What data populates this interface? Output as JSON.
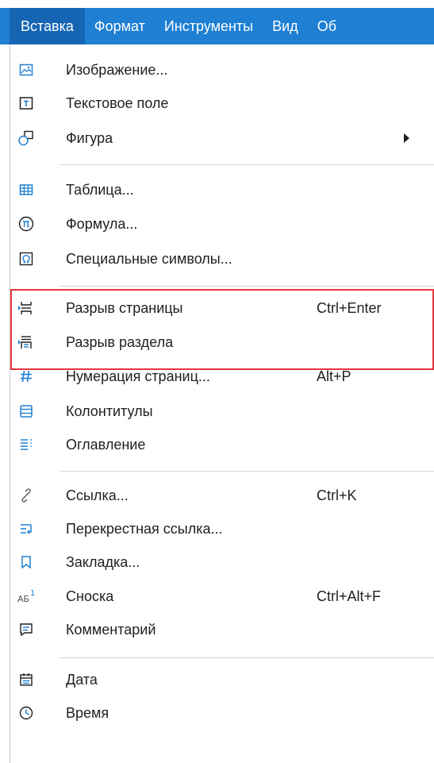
{
  "menubar": {
    "items": [
      {
        "label": "Вставка",
        "active": true
      },
      {
        "label": "Формат"
      },
      {
        "label": "Инструменты"
      },
      {
        "label": "Вид"
      },
      {
        "label": "Об"
      }
    ]
  },
  "colors": {
    "menubar_bg": "#1e7fd3",
    "menubar_active_bg": "#1565b3",
    "icon_blue": "#1e7fd3",
    "highlight_border": "#e53340"
  },
  "menu": {
    "items": [
      {
        "label": "Изображение...",
        "icon": "image-icon"
      },
      {
        "label": "Текстовое поле",
        "icon": "text-field-icon"
      },
      {
        "label": "Фигура",
        "icon": "shape-icon",
        "submenu": true
      },
      {
        "label": "Таблица...",
        "icon": "table-icon"
      },
      {
        "label": "Формула...",
        "icon": "formula-icon"
      },
      {
        "label": "Специальные символы...",
        "icon": "special-symbols-icon"
      },
      {
        "label": "Разрыв страницы",
        "icon": "page-break-icon",
        "shortcut": "Ctrl+Enter"
      },
      {
        "label": "Разрыв раздела",
        "icon": "section-break-icon"
      },
      {
        "label": "Нумерация страниц...",
        "icon": "page-numbering-icon",
        "shortcut": "Alt+P"
      },
      {
        "label": "Колонтитулы",
        "icon": "header-footer-icon"
      },
      {
        "label": "Оглавление",
        "icon": "table-of-contents-icon"
      },
      {
        "label": "Ссылка...",
        "icon": "link-icon",
        "shortcut": "Ctrl+K"
      },
      {
        "label": "Перекрестная ссылка...",
        "icon": "cross-reference-icon"
      },
      {
        "label": "Закладка...",
        "icon": "bookmark-icon"
      },
      {
        "label": "Сноска",
        "icon": "footnote-icon",
        "shortcut": "Ctrl+Alt+F"
      },
      {
        "label": "Комментарий",
        "icon": "comment-icon"
      },
      {
        "label": "Дата",
        "icon": "date-icon"
      },
      {
        "label": "Время",
        "icon": "time-icon"
      }
    ]
  }
}
